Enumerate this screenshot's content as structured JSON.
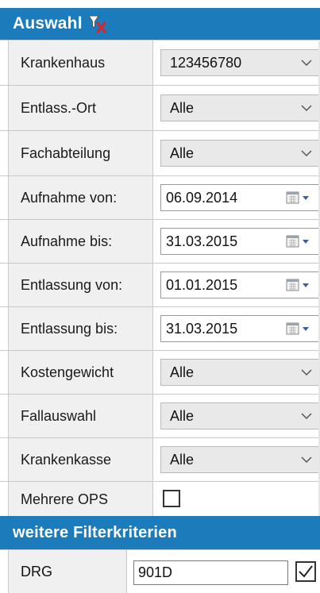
{
  "header": {
    "title": "Auswahl",
    "icon": "filter-clear-icon"
  },
  "fields": [
    {
      "label": "Krankenhaus",
      "type": "combo",
      "value": "123456780"
    },
    {
      "label": "Entlass.-Ort",
      "type": "combo",
      "value": "Alle"
    },
    {
      "label": "Fachabteilung",
      "type": "combo",
      "value": "Alle"
    },
    {
      "label": "Aufnahme von:",
      "type": "date",
      "value": "06.09.2014"
    },
    {
      "label": "Aufnahme bis:",
      "type": "date",
      "value": "31.03.2015"
    },
    {
      "label": "Entlassung von:",
      "type": "date",
      "value": "01.01.2015"
    },
    {
      "label": "Entlassung bis:",
      "type": "date",
      "value": "31.03.2015"
    },
    {
      "label": "Kostengewicht",
      "type": "combo",
      "value": "Alle"
    },
    {
      "label": "Fallauswahl",
      "type": "combo",
      "value": "Alle"
    },
    {
      "label": "Krankenkasse",
      "type": "combo",
      "value": "Alle"
    }
  ],
  "mehrere_ops": {
    "label": "Mehrere OPS",
    "checked": false
  },
  "filter_section": {
    "title": "weitere Filterkriterien"
  },
  "drg": {
    "label": "DRG",
    "value": "901D",
    "checked": true
  },
  "colors": {
    "header_bg": "#1b7bbb",
    "label_bg": "#f0f0f0",
    "combo_bg": "#e9e9e9"
  }
}
